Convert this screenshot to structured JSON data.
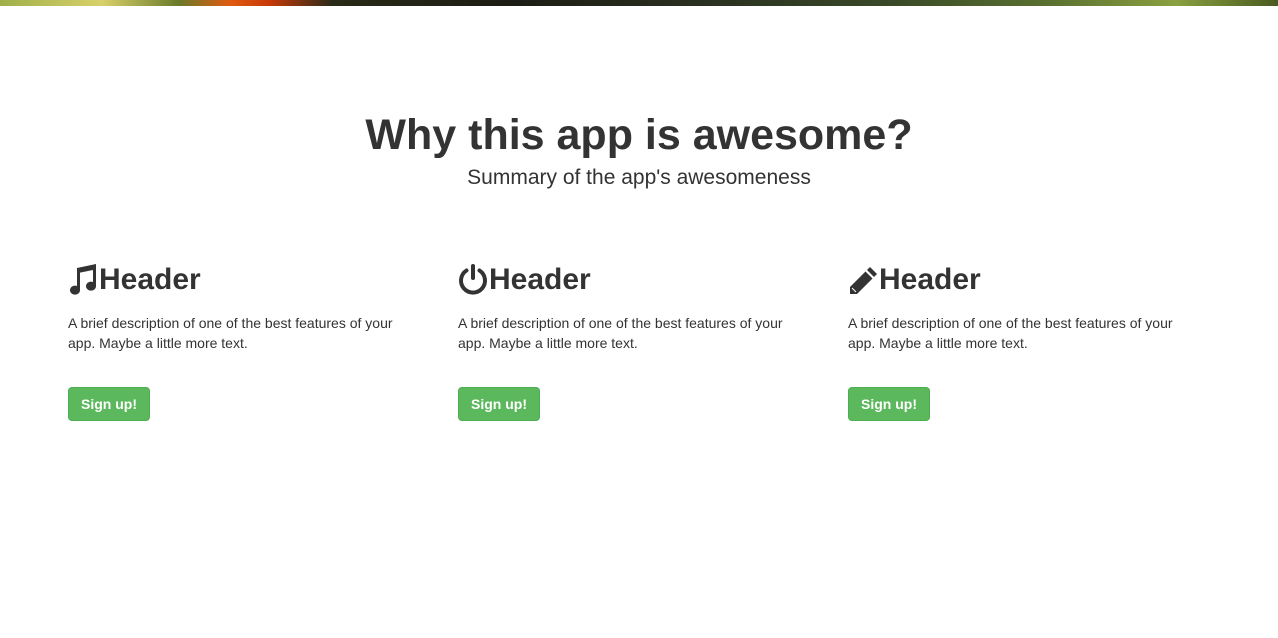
{
  "section": {
    "title": "Why this app is awesome?",
    "subtitle": "Summary of the app's awesomeness"
  },
  "features": [
    {
      "icon": "music-note-icon",
      "title": "Header",
      "description": "A brief description of one of the best features of your app. Maybe a little more text.",
      "button_label": "Sign up!"
    },
    {
      "icon": "power-icon",
      "title": "Header",
      "description": "A brief description of one of the best features of your app. Maybe a little more text.",
      "button_label": "Sign up!"
    },
    {
      "icon": "pencil-icon",
      "title": "Header",
      "description": "A brief description of one of the best features of your app. Maybe a little more text.",
      "button_label": "Sign up!"
    }
  ],
  "colors": {
    "text": "#333333",
    "button_bg": "#5cb85c",
    "button_border": "#4cae4c",
    "button_text": "#ffffff"
  }
}
